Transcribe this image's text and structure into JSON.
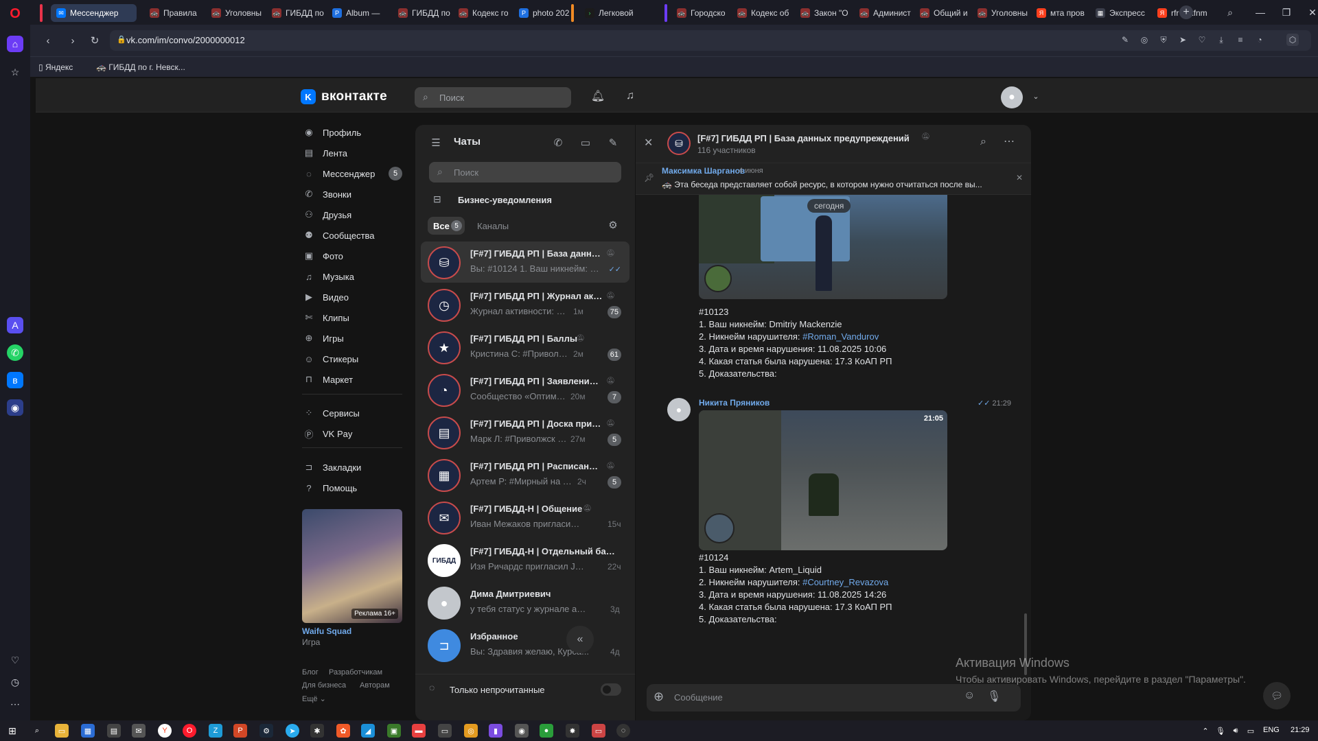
{
  "browser": {
    "tabs": [
      {
        "label": "Мессенджер",
        "active": true
      },
      {
        "label": "Правила"
      },
      {
        "label": "Уголовны"
      },
      {
        "label": "ГИБДД по"
      },
      {
        "label": "Album —"
      },
      {
        "label": "ГИБДД по"
      },
      {
        "label": "Кодекс го"
      },
      {
        "label": "photo 202"
      },
      {
        "label": "Легковой"
      },
      {
        "label": "Городско"
      },
      {
        "label": "Кодекс об"
      },
      {
        "label": "Закон \"О"
      },
      {
        "label": "Админист"
      },
      {
        "label": "Общий и"
      },
      {
        "label": "Уголовны"
      },
      {
        "label": "мта пров"
      },
      {
        "label": "Экспресс"
      },
      {
        "label": "rfr cltkfnm"
      }
    ],
    "url": "vk.com/im/convo/2000000012",
    "bookmarks": [
      {
        "label": "Яндекс"
      },
      {
        "label": "ГИБДД по г. Невск..."
      }
    ]
  },
  "vk": {
    "logo_text": "вконтакте",
    "search_placeholder": "Поиск",
    "nav": [
      {
        "label": "Профиль",
        "icon": "profile-icon"
      },
      {
        "label": "Лента",
        "icon": "feed-icon"
      },
      {
        "label": "Мессенджер",
        "icon": "messenger-icon",
        "count": "5"
      },
      {
        "label": "Звонки",
        "icon": "calls-icon"
      },
      {
        "label": "Друзья",
        "icon": "friends-icon"
      },
      {
        "label": "Сообщества",
        "icon": "communities-icon"
      },
      {
        "label": "Фото",
        "icon": "photo-icon"
      },
      {
        "label": "Музыка",
        "icon": "music-icon"
      },
      {
        "label": "Видео",
        "icon": "video-icon"
      },
      {
        "label": "Клипы",
        "icon": "clips-icon"
      },
      {
        "label": "Игры",
        "icon": "games-icon"
      },
      {
        "label": "Стикеры",
        "icon": "stickers-icon"
      },
      {
        "label": "Маркет",
        "icon": "market-icon"
      },
      {
        "label": "Сервисы",
        "icon": "services-icon"
      },
      {
        "label": "VK Pay",
        "icon": "vkpay-icon"
      },
      {
        "label": "Закладки",
        "icon": "bookmarks-icon"
      },
      {
        "label": "Помощь",
        "icon": "help-icon"
      }
    ],
    "ad": {
      "title": "Waifu Squad",
      "subtitle": "Игра",
      "age": "Реклама 16+"
    },
    "footer_links": [
      "Блог",
      "Разработчикам",
      "Для бизнеса",
      "Авторам",
      "Ещё"
    ]
  },
  "chats": {
    "title": "Чаты",
    "search_placeholder": "Поиск",
    "business": "Бизнес-уведомления",
    "tab_all": "Все",
    "tab_all_count": "5",
    "tab_channels": "Каналы",
    "unread_only": "Только непрочитанные",
    "items": [
      {
        "name": "[F#7] ГИБДД РП | База данны...",
        "preview": "Вы: #10124 1. Ваш никнейм: Ar...",
        "time": "",
        "badge": "",
        "icon": "database-icon",
        "muted": true,
        "active": true
      },
      {
        "name": "[F#7] ГИБДД РП | Журнал акт...",
        "preview": "Журнал активности: ✅ [П...",
        "time": "1м",
        "badge": "75",
        "icon": "clock-icon",
        "muted": true
      },
      {
        "name": "[F#7] ГИБДД РП | Баллы",
        "preview": "Кристина С: #Приволжск ...",
        "time": "2м",
        "badge": "61",
        "icon": "star-icon",
        "muted": true
      },
      {
        "name": "[F#7] ГИБДД РП | Заявления н...",
        "preview": "Сообщество «Оптимизац...",
        "time": "20м",
        "badge": "7",
        "icon": "gauge-icon",
        "muted": true
      },
      {
        "name": "[F#7] ГИБДД РП | Доска прик...",
        "preview": "Марк Л: #Приволжск #Вз...",
        "time": "27м",
        "badge": "5",
        "icon": "document-icon",
        "muted": true
      },
      {
        "name": "[F#7] ГИБДД РП | Расписание ...",
        "preview": "Артем Р: #Мирный на 12.0...",
        "time": "2ч",
        "badge": "5",
        "icon": "calendar-icon",
        "muted": true
      },
      {
        "name": "[F#7] ГИБДД-Н | Общение",
        "preview": "Иван Межаков пригласил Гле...",
        "time": "15ч",
        "badge": "",
        "icon": "mail-icon",
        "muted": true
      },
      {
        "name": "[F#7] ГИБДД-Н | Отдельный бата...",
        "preview": "Изя Ричардс пригласил Jerry ...",
        "time": "22ч",
        "badge": "",
        "icon": "gibdd-logo-icon",
        "icon_text": "ГИБДД",
        "muted": false
      },
      {
        "name": "Дима Дмитриевич",
        "preview": "у тебя статус у журнале актин...",
        "time": "3д",
        "badge": "",
        "icon": "user-avatar-icon",
        "muted": false
      },
      {
        "name": "Избранное",
        "preview": "Вы: Здравия желаю, Курса...",
        "time": "4д",
        "badge": "",
        "icon": "bookmark-icon",
        "muted": false
      }
    ]
  },
  "conversation": {
    "title": "[F#7] ГИБДД РП | База данных предупреждений",
    "members": "116 участников",
    "pinned_author": "Максимка Шарганов",
    "pinned_date": "4 июня",
    "pinned_text": "🚓 Эта беседа представляет собой ресурс, в котором нужно отчитаться после вы...",
    "date_label": "сегодня",
    "messages": [
      {
        "author": "",
        "time": "",
        "shot_hud": "",
        "lines": [
          {
            "text": "#10123"
          },
          {
            "text": "1. Ваш никнейм: Dmitriy Mackenzie"
          },
          {
            "prefix": "2. Никнейм нарушителя: ",
            "link": "#Roman_Vandurov"
          },
          {
            "text": "3. Дата и время нарушения: 11.08.2025 10:06"
          },
          {
            "text": "4. Какая статья была нарушена: 17.3 КоАП РП"
          },
          {
            "text": "5. Доказательства:"
          }
        ]
      },
      {
        "author": "Никита Пряников",
        "time": "21:29",
        "shot_hud": "21:05",
        "lines": [
          {
            "text": "#10124"
          },
          {
            "text": "1. Ваш никнейм: Artem_Liquid"
          },
          {
            "prefix": "2. Никнейм нарушителя: ",
            "link": "#Courtney_Revazova"
          },
          {
            "text": "3. Дата и время нарушения: 11.08.2025 14:26"
          },
          {
            "text": "4. Какая статья была нарушена: 17.3 КоАП РП"
          },
          {
            "text": "5. Доказательства:"
          }
        ]
      }
    ],
    "composer_placeholder": "Сообщение"
  },
  "windows": {
    "activation_title": "Активация Windows",
    "activation_text": "Чтобы активировать Windows, перейдите в раздел \"Параметры\".",
    "tray_lang": "ENG",
    "tray_time": "21:29"
  },
  "colors": {
    "accent": "#0077ff",
    "link": "#71aaeb",
    "panel": "#222222",
    "bg": "#141414"
  }
}
